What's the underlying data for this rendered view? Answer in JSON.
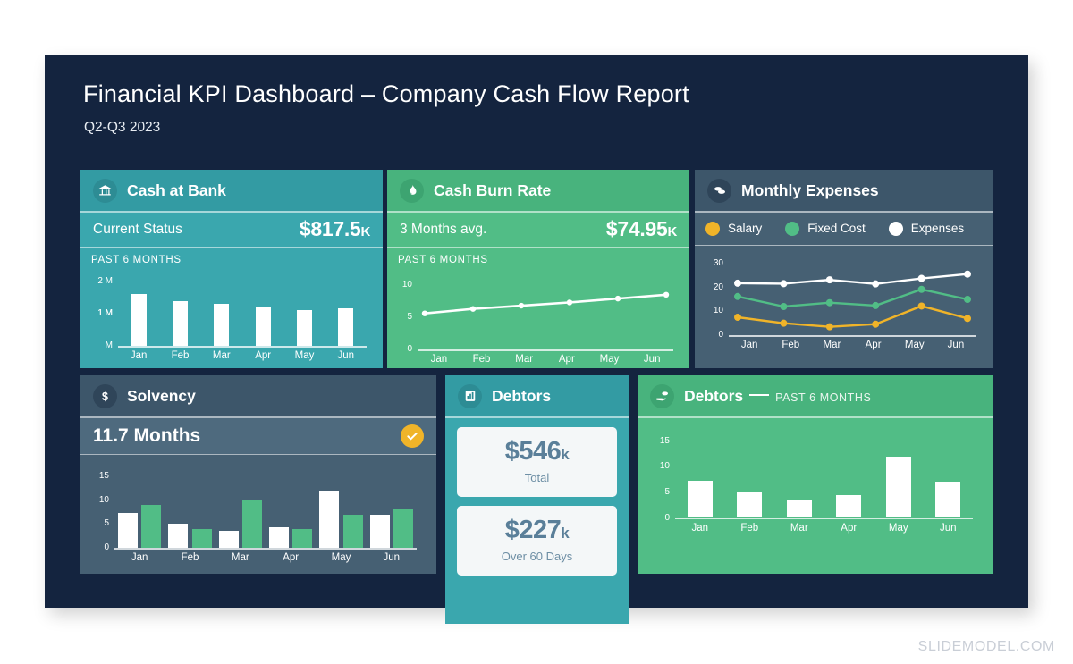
{
  "slide": {
    "title": "Financial KPI Dashboard – Company Cash Flow Report",
    "subtitle": "Q2-Q3 2023",
    "watermark": "SLIDEMODEL.COM",
    "colors": {
      "background": "#14243f",
      "teal": "#3aa7ae",
      "green": "#51bd86",
      "slate": "#466073",
      "yellow": "#f0b429",
      "white": "#ffffff",
      "stat_text": "#5a7f99"
    }
  },
  "cards": {
    "cash_at_bank": {
      "title": "Cash at Bank",
      "icon": "bank-icon",
      "kpi_label": "Current Status",
      "kpi_value": "$817.5",
      "kpi_unit": "K",
      "chart_caption": "PAST 6 MONTHS"
    },
    "cash_burn_rate": {
      "title": "Cash Burn Rate",
      "icon": "flame-icon",
      "kpi_label": "3 Months avg.",
      "kpi_value": "$74.95",
      "kpi_unit": "K",
      "chart_caption": "PAST 6 MONTHS"
    },
    "monthly_expenses": {
      "title": "Monthly Expenses",
      "icon": "coins-icon",
      "legend": [
        {
          "label": "Salary",
          "color": "#f0b429"
        },
        {
          "label": "Fixed Cost",
          "color": "#51bd86"
        },
        {
          "label": "Expenses",
          "color": "#ffffff"
        }
      ]
    },
    "solvency": {
      "title": "Solvency",
      "icon": "dollar-icon",
      "kpi_value": "11.7 Months",
      "status_icon": "check-icon"
    },
    "debtors_kpi": {
      "title": "Debtors",
      "icon": "bar-chart-icon",
      "stats": [
        {
          "value": "$546",
          "unit": "k",
          "caption": "Total"
        },
        {
          "value": "$227",
          "unit": "k",
          "caption": "Over 60 Days"
        }
      ]
    },
    "debtors_chart": {
      "title": "Debtors",
      "icon": "hand-money-icon",
      "title_note": "PAST 6 MONTHS"
    }
  },
  "chart_data": [
    {
      "id": "cash_at_bank_chart",
      "type": "bar",
      "title": "Cash at Bank – Past 6 Months",
      "categories": [
        "Jan",
        "Feb",
        "Mar",
        "Apr",
        "May",
        "Jun"
      ],
      "values": [
        1.62,
        1.38,
        1.3,
        1.22,
        1.12,
        1.18
      ],
      "ylabel": "",
      "xlabel": "",
      "ylim": [
        0,
        2
      ],
      "yticks": [
        2,
        1,
        1,
        0
      ],
      "ytick_labels": [
        "2 M",
        "1 M",
        "1 M",
        "M"
      ],
      "grid": false,
      "series_color": "#ffffff"
    },
    {
      "id": "cash_burn_rate_chart",
      "type": "line",
      "title": "Cash Burn Rate – Past 6 Months",
      "categories": [
        "Jan",
        "Feb",
        "Mar",
        "Apr",
        "May",
        "Jun"
      ],
      "values": [
        5.6,
        6.3,
        6.8,
        7.3,
        7.9,
        8.5
      ],
      "ylim": [
        0,
        10
      ],
      "yticks": [
        0,
        5,
        10
      ],
      "ytick_labels": [
        "0",
        "5",
        "10"
      ],
      "grid": false,
      "series_color": "#ffffff"
    },
    {
      "id": "monthly_expenses_chart",
      "type": "line",
      "title": "Monthly Expenses",
      "categories": [
        "Jan",
        "Feb",
        "Mar",
        "Apr",
        "May",
        "Jun"
      ],
      "series": [
        {
          "name": "Salary",
          "color": "#f0b429",
          "values": [
            7.5,
            5.0,
            3.5,
            4.6,
            12.2,
            7.0
          ]
        },
        {
          "name": "Fixed Cost",
          "color": "#51bd86",
          "values": [
            16.2,
            12.0,
            13.6,
            12.4,
            19.2,
            15.0
          ]
        },
        {
          "name": "Expenses",
          "color": "#ffffff",
          "values": [
            21.8,
            21.6,
            23.2,
            21.5,
            23.8,
            25.6
          ]
        }
      ],
      "ylim": [
        0,
        30
      ],
      "yticks": [
        0,
        10,
        20,
        30
      ],
      "ytick_labels": [
        "0",
        "10",
        "20",
        "30"
      ],
      "grid": false,
      "legend_position": "top"
    },
    {
      "id": "solvency_chart",
      "type": "bar",
      "title": "Solvency",
      "categories": [
        "Jan",
        "Feb",
        "Mar",
        "Apr",
        "May",
        "Jun"
      ],
      "series": [
        {
          "name": "white",
          "color": "#ffffff",
          "values": [
            7.3,
            5.0,
            3.5,
            4.4,
            12.0,
            7.0
          ]
        },
        {
          "name": "green",
          "color": "#51bd86",
          "values": [
            9.0,
            4.0,
            10.0,
            4.0,
            7.0,
            8.0
          ]
        }
      ],
      "ylim": [
        0,
        15
      ],
      "yticks": [
        0,
        5,
        10,
        15
      ],
      "ytick_labels": [
        "0",
        "5",
        "10",
        "15"
      ],
      "grid": false
    },
    {
      "id": "debtors_chart",
      "type": "bar",
      "title": "Debtors – Past 6 Months",
      "categories": [
        "Jan",
        "Feb",
        "Mar",
        "Apr",
        "May",
        "Jun"
      ],
      "values": [
        7.3,
        5.0,
        3.5,
        4.4,
        12.0,
        7.0
      ],
      "ylim": [
        0,
        15
      ],
      "yticks": [
        0,
        5,
        10,
        15
      ],
      "ytick_labels": [
        "0",
        "5",
        "10",
        "15"
      ],
      "grid": false,
      "series_color": "#ffffff"
    }
  ]
}
